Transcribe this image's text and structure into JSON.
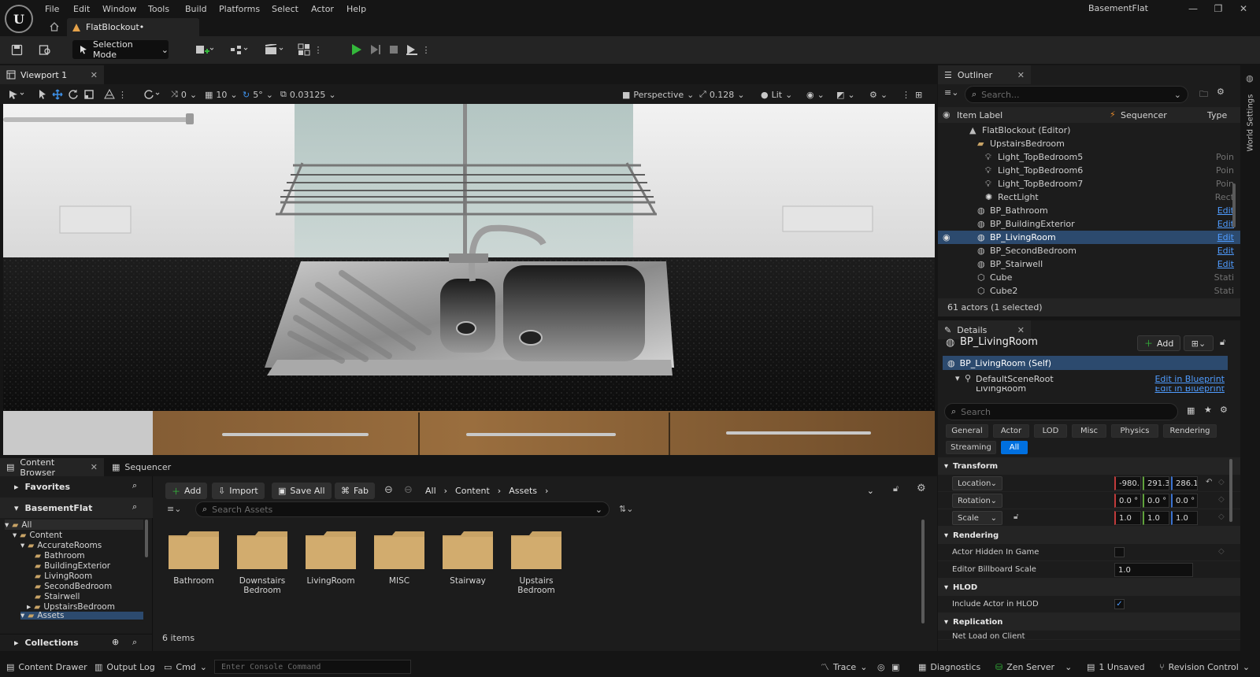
{
  "app": {
    "project_name": "BasementFlat",
    "document_tab": "FlatBlockout•",
    "menu": [
      "File",
      "Edit",
      "Window",
      "Tools",
      "Build",
      "Platforms",
      "Select",
      "Actor",
      "Help"
    ]
  },
  "toolbar": {
    "selection_mode": "Selection Mode"
  },
  "viewport": {
    "tab_label": "Viewport 1",
    "rotation_snap_count": "0",
    "grid_snap": "10",
    "angle_snap": "5°",
    "scale_snap": "0.03125",
    "view_mode": "Perspective",
    "camera_speed": "0.128",
    "lighting_mode": "Lit"
  },
  "outliner": {
    "tab_label": "Outliner",
    "search_placeholder": "Search...",
    "columns": {
      "label": "Item Label",
      "sequencer": "Sequencer",
      "type": "Type"
    },
    "rows": [
      {
        "label": "FlatBlockout (Editor)",
        "type": ""
      },
      {
        "label": "UpstairsBedroom",
        "type": ""
      },
      {
        "label": "Light_TopBedroom5",
        "type": "Poin"
      },
      {
        "label": "Light_TopBedroom6",
        "type": "Poin"
      },
      {
        "label": "Light_TopBedroom7",
        "type": "Poin"
      },
      {
        "label": "RectLight",
        "type": "Rect"
      },
      {
        "label": "BP_Bathroom",
        "type": "Edit"
      },
      {
        "label": "BP_BuildingExterior",
        "type": "Edit"
      },
      {
        "label": "BP_LivingRoom",
        "type": "Edit"
      },
      {
        "label": "BP_SecondBedroom",
        "type": "Edit"
      },
      {
        "label": "BP_Stairwell",
        "type": "Edit"
      },
      {
        "label": "Cube",
        "type": "Stati"
      },
      {
        "label": "Cube2",
        "type": "Stati"
      }
    ],
    "status": "61 actors (1 selected)"
  },
  "world_settings_tab": "World Settings",
  "details": {
    "tab_label": "Details",
    "actor_name": "BP_LivingRoom",
    "add_label": "Add",
    "components": [
      {
        "label": "BP_LivingRoom (Self)",
        "action": ""
      },
      {
        "label": "DefaultSceneRoot",
        "action": "Edit in Blueprint"
      },
      {
        "label": "LivingRoom",
        "action": "Edit in Blueprint"
      }
    ],
    "search_placeholder": "Search",
    "categories": [
      "General",
      "Actor",
      "LOD",
      "Misc",
      "Physics",
      "Rendering",
      "Streaming",
      "All"
    ],
    "active_category": "All",
    "sections": {
      "transform": "Transform",
      "rendering": "Rendering",
      "hlod": "HLOD",
      "replication": "Replication"
    },
    "transform": {
      "location_label": "Location",
      "location": [
        "-980.",
        "291.3",
        "286.1"
      ],
      "rotation_label": "Rotation",
      "rotation": [
        "0.0 °",
        "0.0 °",
        "0.0 °"
      ],
      "scale_label": "Scale",
      "scale": [
        "1.0",
        "1.0",
        "1.0"
      ]
    },
    "rendering": {
      "actor_hidden_label": "Actor Hidden In Game",
      "actor_hidden": false,
      "billboard_label": "Editor Billboard Scale",
      "billboard_value": "1.0"
    },
    "hlod": {
      "include_label": "Include Actor in HLOD",
      "include": true
    },
    "replication": {
      "net_load_label": "Net Load on Client"
    }
  },
  "content_browser": {
    "tab_label": "Content Browser",
    "sequencer_tab": "Sequencer",
    "add_label": "Add",
    "import_label": "Import",
    "save_all_label": "Save All",
    "fab_label": "Fab",
    "breadcrumb": [
      "All",
      "Content",
      "Assets"
    ],
    "search_placeholder": "Search Assets",
    "favorites_label": "Favorites",
    "project_label": "BasementFlat",
    "collections_label": "Collections",
    "tree": [
      {
        "label": "All",
        "depth": 0
      },
      {
        "label": "Content",
        "depth": 1
      },
      {
        "label": "AccurateRooms",
        "depth": 2
      },
      {
        "label": "Bathroom",
        "depth": 3
      },
      {
        "label": "BuildingExterior",
        "depth": 3
      },
      {
        "label": "LivingRoom",
        "depth": 3
      },
      {
        "label": "SecondBedroom",
        "depth": 3
      },
      {
        "label": "Stairwell",
        "depth": 3
      },
      {
        "label": "UpstairsBedroom",
        "depth": 3
      },
      {
        "label": "Assets",
        "depth": 2
      }
    ],
    "folders": [
      "Bathroom",
      "Downstairs Bedroom",
      "LivingRoom",
      "MISC",
      "Stairway",
      "Upstairs Bedroom"
    ],
    "item_count": "6 items"
  },
  "statusbar": {
    "content_drawer": "Content Drawer",
    "output_log": "Output Log",
    "cmd": "Cmd",
    "console_placeholder": "Enter Console Command",
    "trace": "Trace",
    "diagnostics": "Diagnostics",
    "zen_server": "Zen Server",
    "unsaved": "1 Unsaved",
    "revision_control": "Revision Control"
  },
  "colors": {
    "accent": "#0070e0",
    "selection": "#2c4a6e",
    "link": "#4f9cff",
    "play_green": "#34b83b",
    "folder": "#c8a366"
  }
}
